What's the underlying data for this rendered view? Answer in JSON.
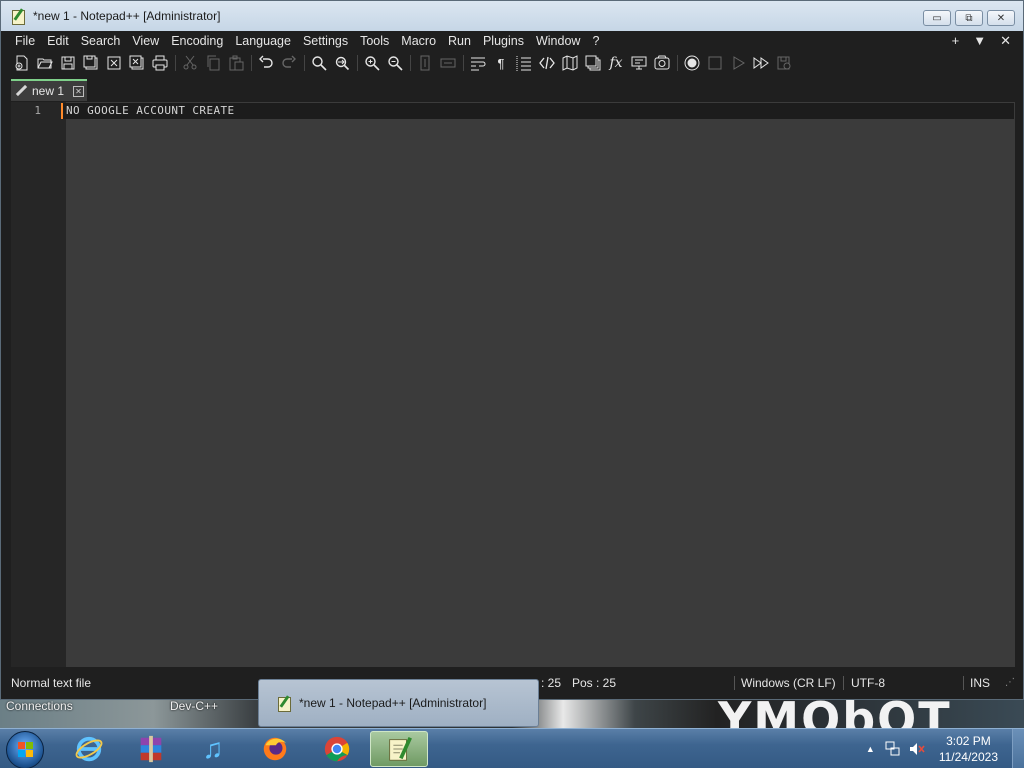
{
  "window": {
    "title": "*new 1 - Notepad++ [Administrator]",
    "controls": {
      "minimize": "▭",
      "maximize": "⧉",
      "close": "✕"
    }
  },
  "menu": {
    "items": [
      "File",
      "Edit",
      "Search",
      "View",
      "Encoding",
      "Language",
      "Settings",
      "Tools",
      "Macro",
      "Run",
      "Plugins",
      "Window",
      "?"
    ],
    "right": {
      "plus": "+",
      "dropdown": "▼",
      "close": "✕"
    }
  },
  "toolbar": {
    "icons": [
      "new-file",
      "open-file",
      "save",
      "save-all",
      "close",
      "close-all",
      "print",
      "cut",
      "copy",
      "paste",
      "undo",
      "redo",
      "find",
      "replace",
      "zoom-in",
      "zoom-out",
      "sync-vertical",
      "sync-horizontal",
      "word-wrap",
      "show-all-chars",
      "indent-guide",
      "udl",
      "document-map",
      "document-list",
      "function-list",
      "folder-as-workspace",
      "monitoring",
      "record-macro",
      "stop-record",
      "play-macro",
      "run-multiple-macros",
      "save-macro"
    ]
  },
  "tab": {
    "label": "new 1",
    "close": "✕"
  },
  "editor": {
    "line_number": "1",
    "content": "NO GOOGLE ACCOUNT CREATE"
  },
  "status": {
    "file_type": "Normal text file",
    "col": ": 25",
    "pos": "Pos : 25",
    "eol": "Windows (CR LF)",
    "encoding": "UTF-8",
    "mode": "INS"
  },
  "desktop": {
    "labels": [
      "Connections",
      "Dev-C++"
    ],
    "art_text": "YMObOT"
  },
  "taskbar": {
    "preview_title": "*new 1 - Notepad++ [Administrator]",
    "apps": [
      "Internet Explorer",
      "WinRAR",
      "iTunes",
      "Firefox",
      "Chrome",
      "Notepad++"
    ],
    "time": "3:02 PM",
    "date": "11/24/2023"
  }
}
